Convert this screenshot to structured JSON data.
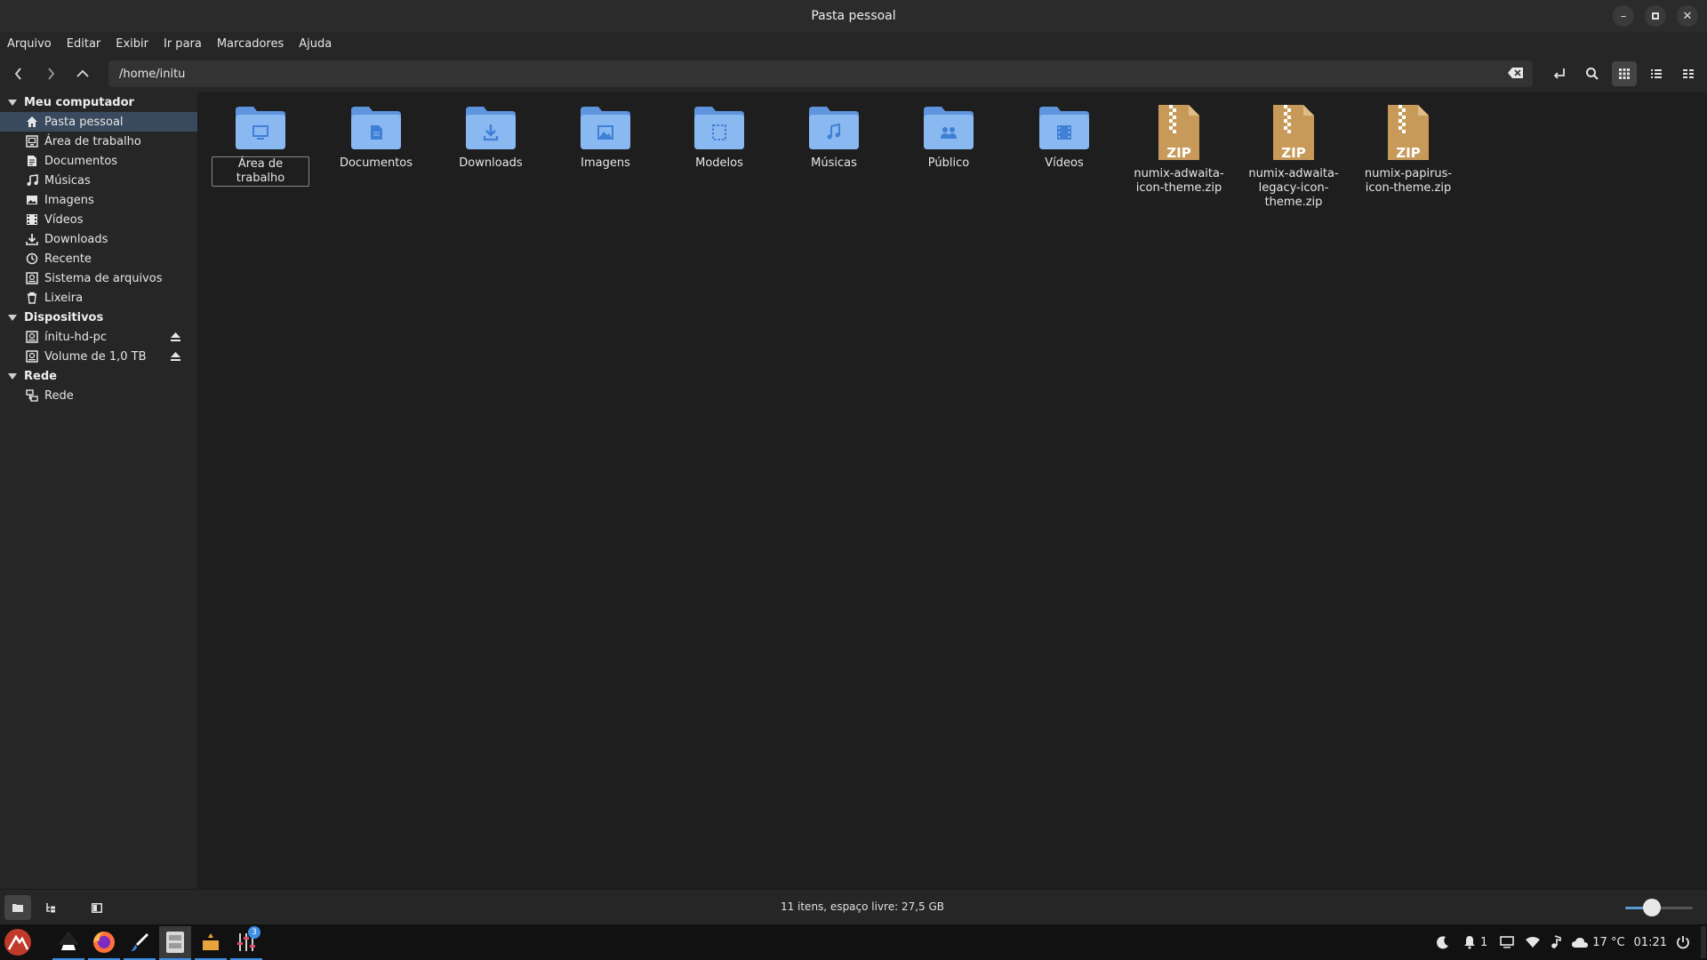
{
  "window": {
    "title": "Pasta pessoal"
  },
  "menu": [
    "Arquivo",
    "Editar",
    "Exibir",
    "Ir para",
    "Marcadores",
    "Ajuda"
  ],
  "location": {
    "path": "/home/initu"
  },
  "sidebar": {
    "sections": {
      "computer": "Meu computador",
      "devices": "Dispositivos",
      "network": "Rede"
    },
    "computer_items": [
      {
        "label": "Pasta pessoal",
        "icon": "home-icon",
        "selected": true
      },
      {
        "label": "Área de trabalho",
        "icon": "desktop-icon"
      },
      {
        "label": "Documentos",
        "icon": "document-icon"
      },
      {
        "label": "Músicas",
        "icon": "music-icon"
      },
      {
        "label": "Imagens",
        "icon": "image-icon"
      },
      {
        "label": "Vídeos",
        "icon": "video-icon"
      },
      {
        "label": "Downloads",
        "icon": "download-icon"
      },
      {
        "label": "Recente",
        "icon": "recent-icon"
      },
      {
        "label": "Sistema de arquivos",
        "icon": "drive-icon"
      },
      {
        "label": "Lixeira",
        "icon": "trash-icon"
      }
    ],
    "device_items": [
      {
        "label": "ínitu-hd-pc",
        "icon": "drive-icon"
      },
      {
        "label": "Volume de 1,0 TB",
        "icon": "drive-icon"
      }
    ],
    "network_items": [
      {
        "label": "Rede",
        "icon": "network-icon"
      }
    ]
  },
  "files": [
    {
      "name": "Área de trabalho",
      "kind": "folder",
      "emblem": "desktop"
    },
    {
      "name": "Documentos",
      "kind": "folder",
      "emblem": "document"
    },
    {
      "name": "Downloads",
      "kind": "folder",
      "emblem": "download"
    },
    {
      "name": "Imagens",
      "kind": "folder",
      "emblem": "image"
    },
    {
      "name": "Modelos",
      "kind": "folder",
      "emblem": "template"
    },
    {
      "name": "Músicas",
      "kind": "folder",
      "emblem": "music"
    },
    {
      "name": "Público",
      "kind": "folder",
      "emblem": "public"
    },
    {
      "name": "Vídeos",
      "kind": "folder",
      "emblem": "video"
    },
    {
      "name": "numix-adwaita-icon-theme.zip",
      "kind": "zip"
    },
    {
      "name": "numix-adwaita-legacy-icon-theme.zip",
      "kind": "zip"
    },
    {
      "name": "numix-papirus-icon-theme.zip",
      "kind": "zip"
    }
  ],
  "zip_label": "ZIP",
  "status": {
    "text": "11 itens, espaço livre: 27,5 GB",
    "zoom_fraction": 0.4
  },
  "taskbar": {
    "badge": "3",
    "notifications": "1",
    "temperature": "17 °C",
    "time": "01:21"
  },
  "colors": {
    "folder": "#8ab8f0",
    "folder_dark": "#5e95de",
    "folder_emblem": "#3f7fd6",
    "zip": "#c89a5a",
    "accent": "#3d8ee6",
    "selection": "#3a4a5e"
  }
}
